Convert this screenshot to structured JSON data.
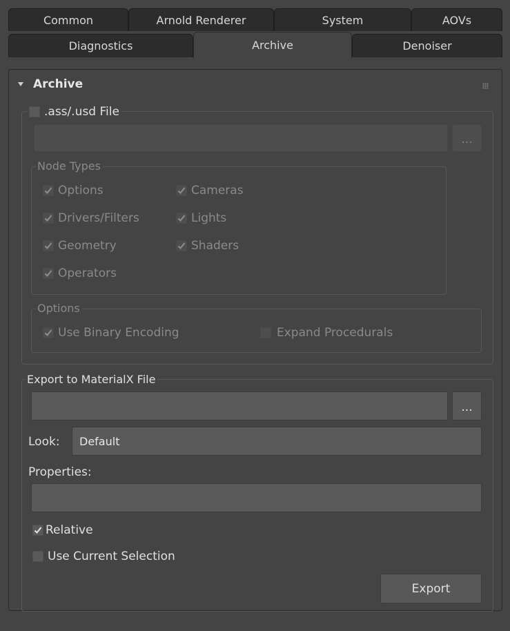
{
  "tabs": {
    "row1": [
      "Common",
      "Arnold Renderer",
      "System",
      "AOVs"
    ],
    "row2": [
      "Diagnostics",
      "Archive",
      "Denoiser"
    ],
    "active": "Archive"
  },
  "rollout": {
    "title": "Archive"
  },
  "ass_file": {
    "checkbox_label": ".ass/.usd File",
    "checked": false,
    "path_value": "",
    "browse_label": "...",
    "node_types": {
      "title": "Node Types",
      "items": [
        {
          "label": "Options",
          "checked": true
        },
        {
          "label": "Cameras",
          "checked": true
        },
        {
          "label": "Drivers/Filters",
          "checked": true
        },
        {
          "label": "Lights",
          "checked": true
        },
        {
          "label": "Geometry",
          "checked": true
        },
        {
          "label": "Shaders",
          "checked": true
        },
        {
          "label": "Operators",
          "checked": true
        }
      ]
    },
    "options": {
      "title": "Options",
      "use_binary_encoding": {
        "label": "Use Binary Encoding",
        "checked": true
      },
      "expand_procedurals": {
        "label": "Expand Procedurals",
        "checked": false
      }
    }
  },
  "materialx": {
    "title": "Export to MaterialX File",
    "path_value": "",
    "browse_label": "...",
    "look_label": "Look:",
    "look_value": "Default",
    "properties_label": "Properties:",
    "properties_value": "",
    "relative": {
      "label": "Relative",
      "checked": true
    },
    "use_current_selection": {
      "label": "Use Current Selection",
      "checked": false
    },
    "export_label": "Export"
  },
  "colors": {
    "background": "#444444",
    "tab_inactive": "#2c2c2c",
    "field": "#595959",
    "text": "#dcdcdc",
    "text_disabled": "#8a8a8a"
  }
}
